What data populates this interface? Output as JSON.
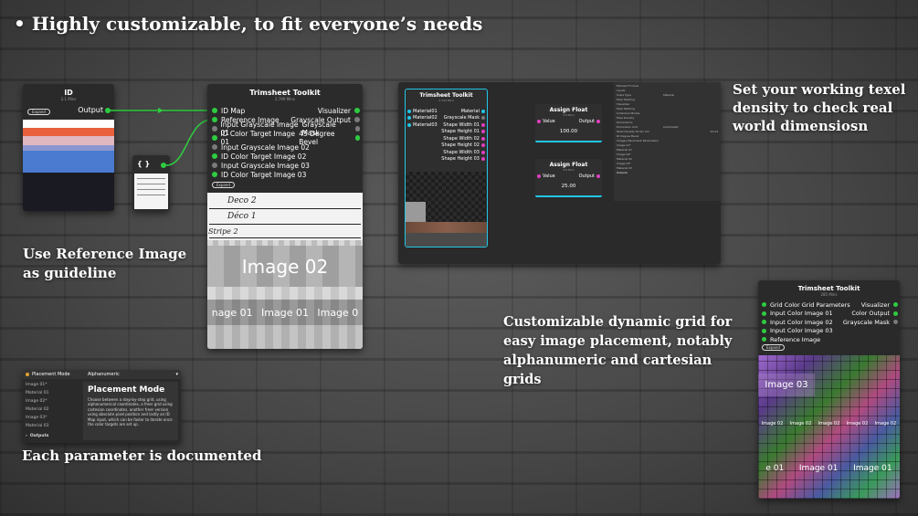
{
  "headline": "• Highly customizable, to fit everyone’s needs",
  "captions": {
    "reference": "Use Reference Image as guideline",
    "documented": "Each parameter is documented",
    "texel": "Set your working texel density to check real world dimensiosn",
    "grid": "Customizable dynamic grid for easy image placement, notably alphanumeric and cartesian grids"
  },
  "id_node": {
    "title": "ID",
    "sub": "2.1 Mins",
    "expand": "Expand",
    "output": "Output"
  },
  "ref_node": {
    "symbol": "{ }"
  },
  "toolkit1": {
    "title": "Trimsheet Toolkit",
    "sub": "2,799 Mins",
    "left": [
      "ID Map",
      "Reference Image",
      "Input Grayscale Image 01",
      "ID Color Target Image 01",
      "Input Grayscale Image 02",
      "ID Color Target Image 02",
      "Input Grayscale Image 03",
      "ID Color Target Image 03"
    ],
    "right": [
      "Visualizer",
      "Grayscale Output",
      "Grayscale Mask",
      "45 Degree Bevel"
    ],
    "expand": "Expand",
    "sketch": [
      "Deco 2",
      "Déco 1",
      "Stripe 2"
    ],
    "image_big": "Image 02",
    "image_small": [
      "nage 01",
      "Image 01",
      "Image 0"
    ]
  },
  "doc_panel": {
    "header_label": "Placement Mode",
    "header_value": "Alphanumeric",
    "list": [
      "Image 01*",
      "Material 01",
      "Image 02*",
      "Material 02",
      "Image 03*",
      "Material 03"
    ],
    "outputs": "Outputs",
    "title": "Placement Mode",
    "body": "Choose between a step-by-step grid, using alphanumerical coordinates, a freer grid using cartesian coordinates, another freer version using absolute pixel position and lastly an ID Map input, which can be faster to iterate once the color targets are set up."
  },
  "graph": {
    "toolkit_title": "Trimsheet Toolkit",
    "toolkit_sub": "2,799 Mins",
    "left": [
      "Material01",
      "Material02",
      "Material03"
    ],
    "right": [
      "Material",
      "Grayscale Mask",
      "Shape Width 01",
      "Shape Height 01",
      "Shape Width 02",
      "Shape Height 02",
      "Shape Width 03",
      "Shape Height 03"
    ],
    "assign1": {
      "title": "Assign Float",
      "sub": "3.9 Mins",
      "value_label": "Value",
      "output_label": "Output",
      "value": "100.00"
    },
    "assign2": {
      "title": "Assign Float",
      "sub": "3.9 Mins",
      "value_label": "Value",
      "output_label": "Output",
      "value": "25.00"
    }
  },
  "props": {
    "rows": [
      "Element Format",
      "Inputs",
      "Scale Type",
      "Pixel Padding",
      "Visualizer",
      "Pixel Padding",
      "Individual Modes",
      "Pixel Density",
      "Dimensions",
      "Dimension Unit",
      "Texel Density Px Per Cm",
      "ID Degree Bevel",
      "Images Placement Parameters",
      "Image 01*",
      "Material 01",
      "Image 02*",
      "Material 02",
      "Image 03*",
      "Material 03",
      "Outputs"
    ],
    "scale_value": "Material",
    "unit_value": "Centimeter",
    "density_value": "10.24"
  },
  "toolkit2": {
    "title": "Trimsheet Toolkit",
    "sub": "285 Mins",
    "left": [
      "Grid Color Grid Parameters",
      "Input Color Image 01",
      "Input Color Image 02",
      "Input Color Image 03",
      "Reference Image"
    ],
    "right": [
      "Visualizer",
      "Color Output",
      "Grayscale Mask"
    ],
    "expand": "Expand",
    "tile_big": "Image 03",
    "tile_small": "Image 02",
    "tile_bottom": [
      "e 01",
      "Image 01",
      "Image 01"
    ]
  }
}
